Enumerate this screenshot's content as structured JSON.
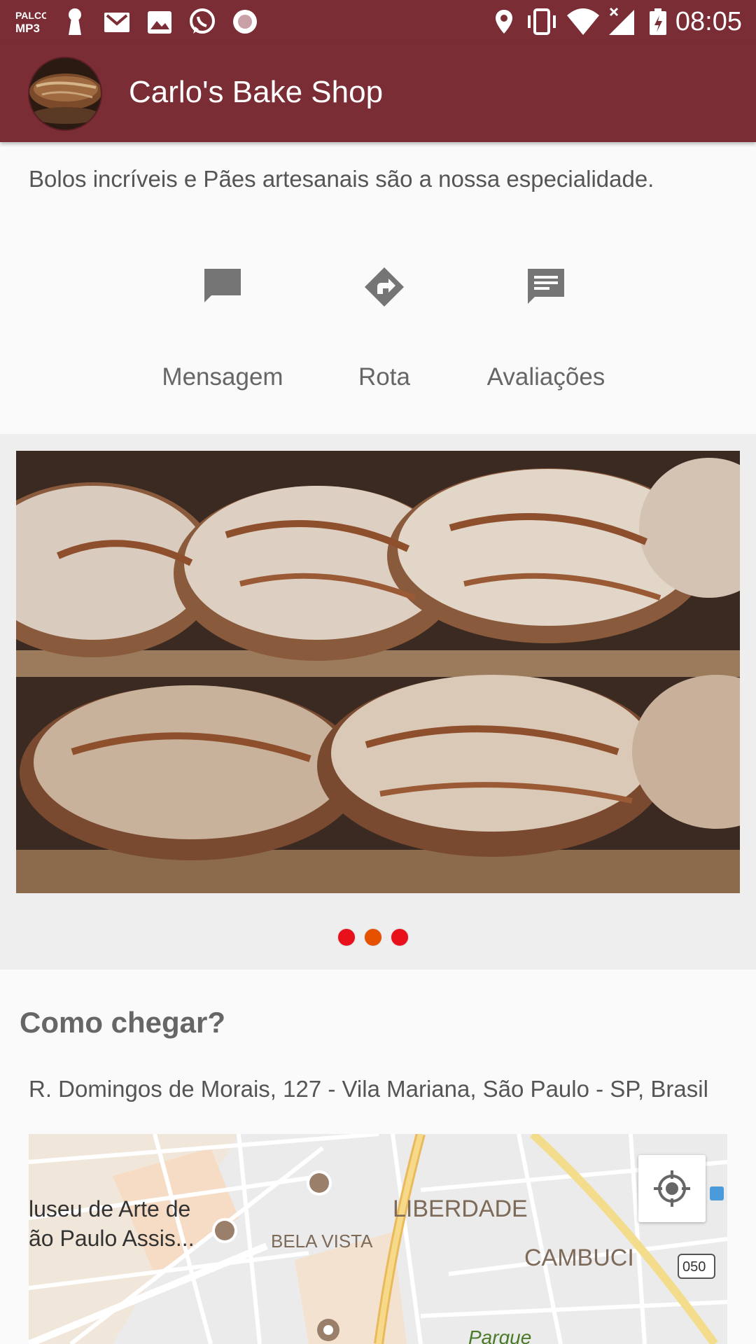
{
  "status_bar": {
    "time": "08:05",
    "left_icons": [
      "palco-mp3-icon",
      "keyhole-icon",
      "gmail-icon",
      "image-icon",
      "whatsapp-icon",
      "record-icon"
    ],
    "right_icons": [
      "location-icon",
      "vibrate-icon",
      "wifi-icon",
      "signal-icon",
      "battery-icon"
    ],
    "palco_label": "PALCO MP3"
  },
  "app_bar": {
    "title": "Carlo's Bake Shop",
    "color": "#7b2d35"
  },
  "tagline": "Bolos incríveis e Pães artesanais são a nossa especialidade.",
  "actions": [
    {
      "label": "Mensagem",
      "icon": "message-icon"
    },
    {
      "label": "Rota",
      "icon": "directions-icon"
    },
    {
      "label": "Avaliações",
      "icon": "reviews-icon"
    }
  ],
  "carousel": {
    "image": "bread-loaves-photo",
    "dots": [
      {
        "color": "#e8101a",
        "active": false
      },
      {
        "color": "#e65100",
        "active": true
      },
      {
        "color": "#e8101a",
        "active": false
      }
    ]
  },
  "directions": {
    "title": "Como chegar?",
    "address": "R. Domingos de Morais, 127 - Vila Mariana, São Paulo - SP, Brasil",
    "map": {
      "labels": {
        "museum": "luseu de Arte de",
        "museum2": "ão Paulo Assis...",
        "bela_vista": "BELA VISTA",
        "liberdade": "LIBERDADE",
        "cambuci": "CAMBUCI",
        "road_shield": "050",
        "parque": "Parque"
      }
    }
  }
}
